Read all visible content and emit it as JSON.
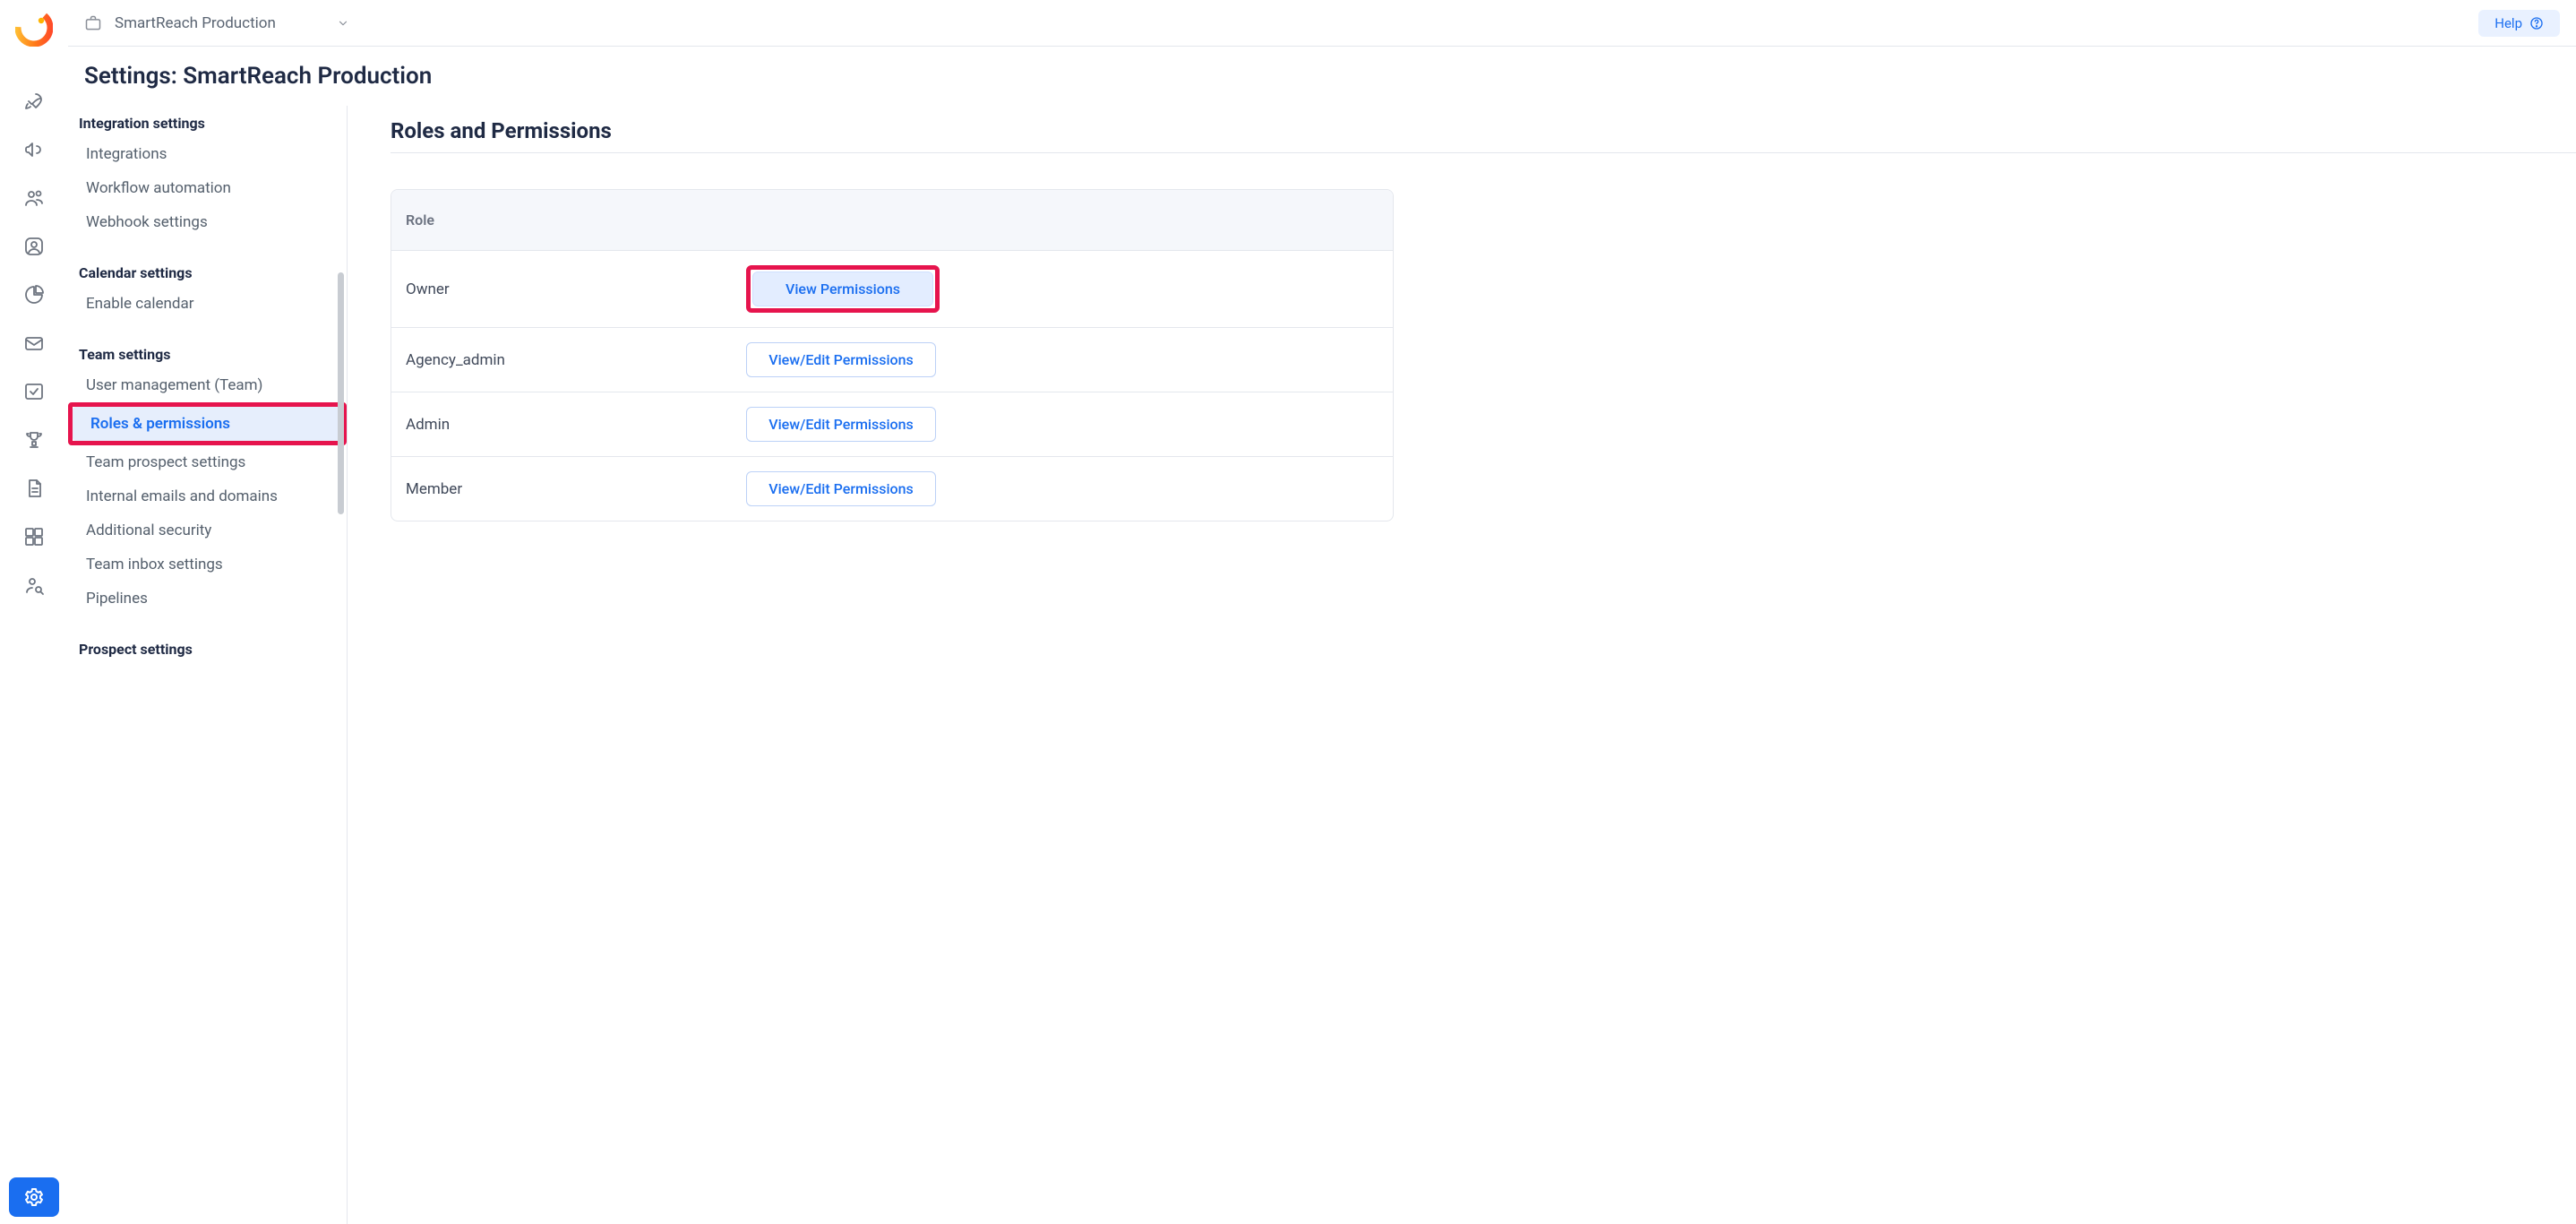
{
  "workspace": {
    "name": "SmartReach Production"
  },
  "topbar": {
    "help_label": "Help"
  },
  "page": {
    "title": "Settings: SmartReach Production"
  },
  "settings_nav": {
    "groups": [
      {
        "title": "Integration settings",
        "items": [
          {
            "label": "Integrations",
            "active": false
          },
          {
            "label": "Workflow automation",
            "active": false
          },
          {
            "label": "Webhook settings",
            "active": false
          }
        ]
      },
      {
        "title": "Calendar settings",
        "items": [
          {
            "label": "Enable calendar",
            "active": false
          }
        ]
      },
      {
        "title": "Team settings",
        "items": [
          {
            "label": "User management (Team)",
            "active": false
          },
          {
            "label": "Roles & permissions",
            "active": true,
            "highlighted": true
          },
          {
            "label": "Team prospect settings",
            "active": false
          },
          {
            "label": "Internal emails and domains",
            "active": false
          },
          {
            "label": "Additional security",
            "active": false
          },
          {
            "label": "Team inbox settings",
            "active": false
          },
          {
            "label": "Pipelines",
            "active": false
          }
        ]
      },
      {
        "title": "Prospect settings",
        "items": []
      }
    ]
  },
  "panel": {
    "heading": "Roles and Permissions",
    "table": {
      "header": "Role",
      "rows": [
        {
          "name": "Owner",
          "action": "View Permissions",
          "style": "filled",
          "highlighted": true
        },
        {
          "name": "Agency_admin",
          "action": "View/Edit Permissions",
          "style": "outline"
        },
        {
          "name": "Admin",
          "action": "View/Edit Permissions",
          "style": "outline"
        },
        {
          "name": "Member",
          "action": "View/Edit Permissions",
          "style": "outline"
        }
      ]
    }
  },
  "rail": {
    "icons": [
      "rocket-icon",
      "megaphone-icon",
      "people-icon",
      "user-circle-icon",
      "pie-icon",
      "mail-icon",
      "check-square-icon",
      "trophy-icon",
      "document-icon",
      "apps-icon",
      "person-search-icon"
    ]
  }
}
